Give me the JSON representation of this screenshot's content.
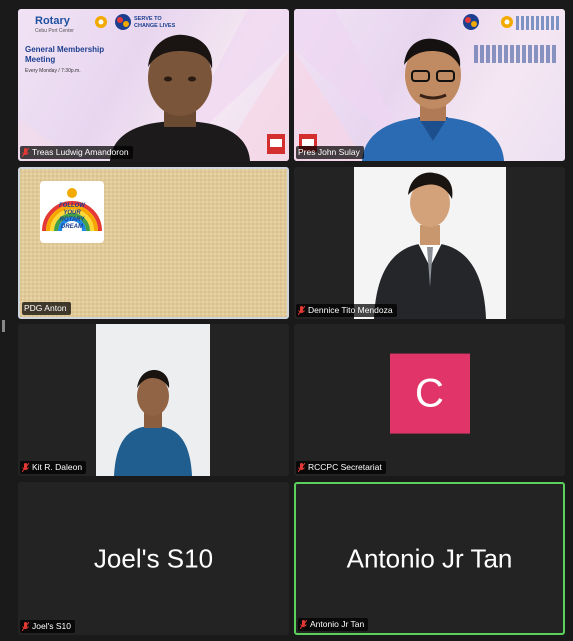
{
  "tiles": [
    {
      "name": "Treas Ludwig Amandoron",
      "overlay": {
        "club": "Rotary",
        "club_sub": "Cebu Port Center",
        "serve": "SERVE TO CHANGE LIVES",
        "meeting": "General Membership Meeting",
        "schedule": "Every Monday / 7:30p.m."
      }
    },
    {
      "name": "Pres John Sulay"
    },
    {
      "name": "PDG Anton",
      "badge_text": "FOLLOW YOUR ROTARY DREAM"
    },
    {
      "name": "Dennice Tito Mendoza"
    },
    {
      "name": "Kit R. Daleon"
    },
    {
      "name": "RCCPC Secretariat",
      "avatar_letter": "C",
      "avatar_color": "#e1356a"
    },
    {
      "name": "Joel's S10",
      "big_name": "Joel's S10"
    },
    {
      "name": "Antonio Jr Tan",
      "big_name": "Antonio Jr Tan",
      "speaking": true
    }
  ],
  "colors": {
    "background": "#1a1a1a",
    "tile": "#232323",
    "speaking_border": "#5bd15b",
    "muted_mic": "#e53935"
  },
  "icons": {
    "muted": "mic-muted-icon",
    "rotary_wheel": "rotary-wheel-icon"
  }
}
